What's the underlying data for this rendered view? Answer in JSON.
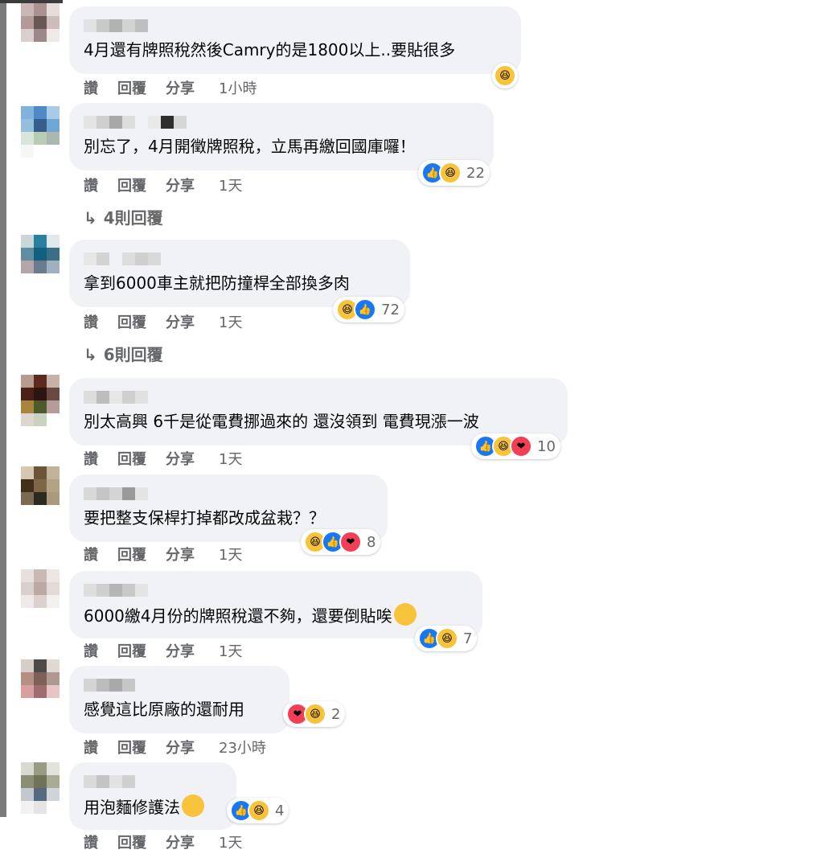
{
  "actions": {
    "like": "讚",
    "reply": "回覆",
    "share": "分享"
  },
  "comments": [
    {
      "text": "4月還有牌照稅然後Camry的是1800以上..要貼很多",
      "time": "1小時",
      "reactions": [
        "haha"
      ],
      "count": ""
    },
    {
      "text": "別忘了，4月開徵牌照稅，立馬再繳回國庫囉！",
      "time": "1天",
      "reactions": [
        "like",
        "haha"
      ],
      "count": "22",
      "replies": "4則回覆"
    },
    {
      "text": "拿到6000車主就把防撞桿全部換多肉",
      "time": "1天",
      "reactions": [
        "haha",
        "like"
      ],
      "count": "72",
      "replies": "6則回覆"
    },
    {
      "text": "別太高興 6千是從電費挪過來的 還沒領到 電費現漲一波",
      "time": "1天",
      "reactions": [
        "like",
        "haha",
        "love"
      ],
      "count": "10"
    },
    {
      "text": "要把整支保桿打掉都改成盆栽？？",
      "time": "1天",
      "reactions": [
        "haha",
        "like",
        "love"
      ],
      "count": "8"
    },
    {
      "text": "6000繳4月份的牌照稅還不夠，還要倒貼唉",
      "time": "1天",
      "reactions": [
        "like",
        "haha"
      ],
      "count": "7"
    },
    {
      "text": "感覺這比原廠的還耐用",
      "time": "23小時",
      "reactions": [
        "love",
        "haha"
      ],
      "count": "2"
    },
    {
      "text": "用泡麵修護法",
      "time": "1天",
      "reactions": [
        "like",
        "haha"
      ],
      "count": "4"
    }
  ],
  "icons": {
    "like": "thumbs-up-icon",
    "haha": "laughing-face-icon",
    "love": "heart-icon",
    "reply_arrow": "reply-arrow-icon"
  },
  "colors": {
    "like": "#1877f2",
    "haha": "#f7c33a",
    "love": "#f33e58",
    "bubble": "#f0f2f5",
    "meta": "#65676b"
  }
}
